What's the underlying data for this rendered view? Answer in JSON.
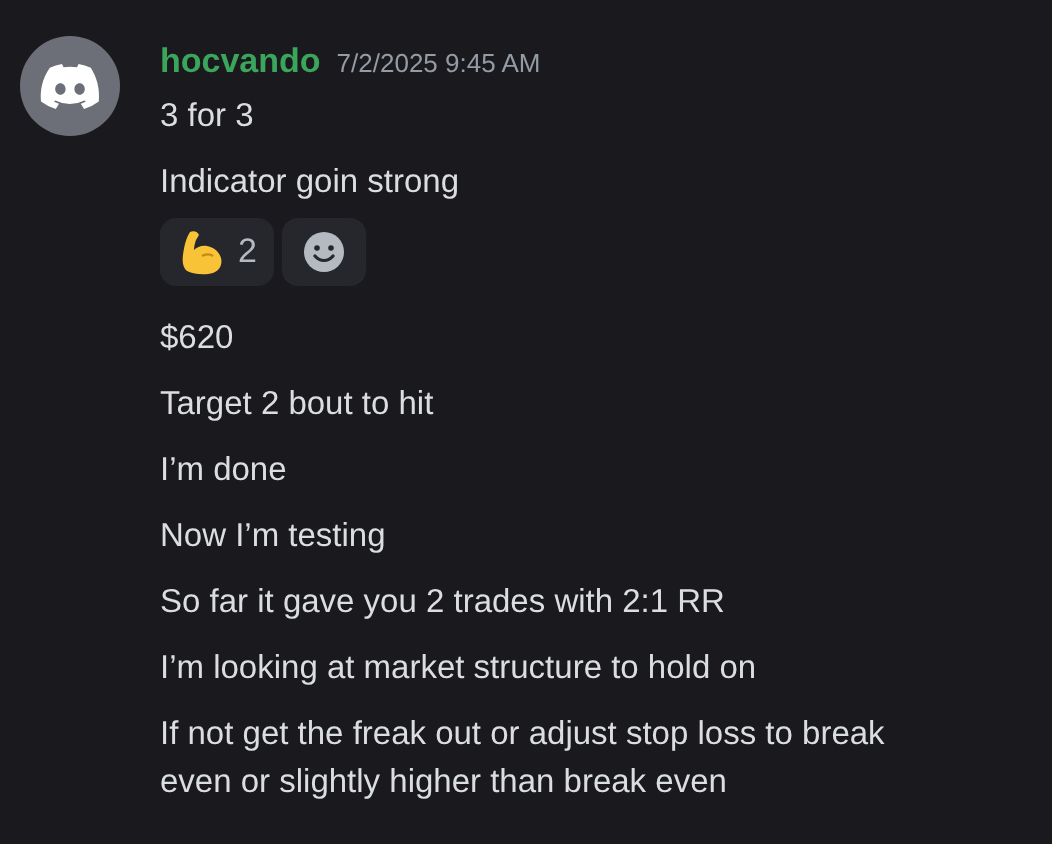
{
  "author": {
    "name": "hocvando"
  },
  "timestamp": "7/2/2025 9:45 AM",
  "messages": [
    {
      "text": "3 for 3"
    },
    {
      "text": "Indicator goin strong",
      "reactions": [
        {
          "kind": "flexed-biceps",
          "count": "2",
          "selected": false
        }
      ]
    },
    {
      "text": "$620"
    },
    {
      "text": "Target 2 bout to hit"
    },
    {
      "text": "I’m done"
    },
    {
      "text": "Now I’m testing"
    },
    {
      "text": "So far it gave you 2 trades with 2:1 RR"
    },
    {
      "text": "I’m looking at market structure to hold on"
    },
    {
      "text": "If not get the freak out or adjust stop loss to break even or slightly higher than break even"
    }
  ]
}
